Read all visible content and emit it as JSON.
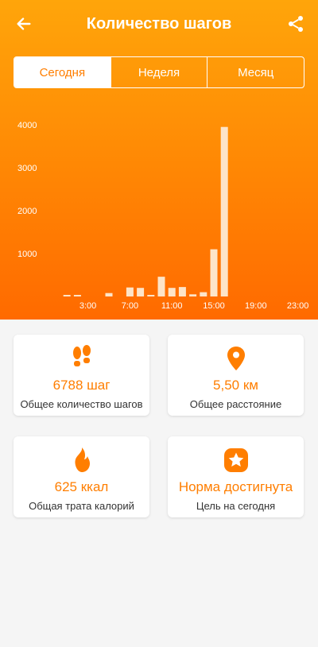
{
  "header": {
    "title": "Количество шагов",
    "back_icon": "arrow-left-icon",
    "share_icon": "share-icon"
  },
  "tabs": [
    {
      "label": "Сегодня",
      "active": true
    },
    {
      "label": "Неделя",
      "active": false
    },
    {
      "label": "Месяц",
      "active": false
    }
  ],
  "chart_data": {
    "type": "bar",
    "ylim": [
      0,
      4000
    ],
    "yticks": [
      "4000",
      "3000",
      "2000",
      "1000"
    ],
    "xticks": [
      "3:00",
      "7:00",
      "11:00",
      "15:00",
      "19:00",
      "23:00"
    ],
    "x": [
      0,
      1,
      2,
      3,
      4,
      5,
      6,
      7,
      8,
      9,
      10,
      11,
      12,
      13,
      14,
      15,
      16,
      17,
      18,
      19,
      20,
      21,
      22,
      23
    ],
    "values": [
      0,
      15,
      15,
      0,
      0,
      80,
      0,
      210,
      200,
      20,
      460,
      200,
      220,
      50,
      100,
      1100,
      3950,
      0,
      0,
      0,
      0,
      0,
      0,
      0
    ],
    "bar_color": "#fde4c8"
  },
  "cards": [
    {
      "value": "6788 шаг",
      "label": "Общее количество шагов",
      "icon": "footsteps-icon"
    },
    {
      "value": "5,50 км",
      "label": "Общее расстояние",
      "icon": "location-pin-icon"
    },
    {
      "value": "625 ккал",
      "label": "Общая трата калорий",
      "icon": "flame-icon"
    },
    {
      "value": "Норма достигнута",
      "label": "Цель на сегодня",
      "icon": "star-badge-icon"
    }
  ],
  "colors": {
    "accent": "#ff7e00",
    "bar": "#fde4c8",
    "bg": "#f5f5f5"
  }
}
